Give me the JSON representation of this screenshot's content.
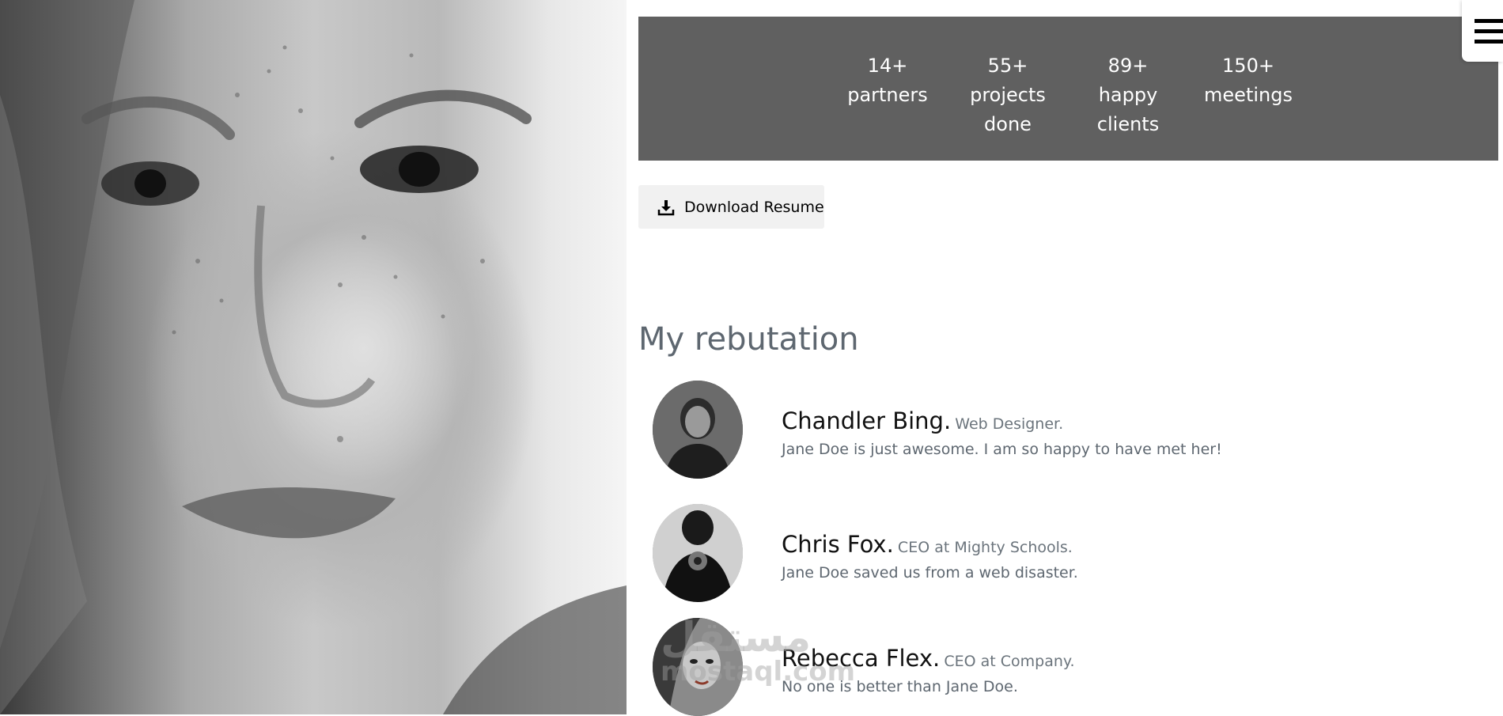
{
  "stats": [
    {
      "lines": [
        "14+",
        "partners"
      ]
    },
    {
      "lines": [
        "55+",
        "projects",
        "done"
      ]
    },
    {
      "lines": [
        "89+",
        "happy",
        "clients"
      ]
    },
    {
      "lines": [
        "150+",
        "meetings"
      ]
    }
  ],
  "download_button": {
    "label": "Download Resume",
    "icon": "download-icon"
  },
  "reputation": {
    "title": "My rebutation",
    "items": [
      {
        "name": "Chandler Bing.",
        "role": "Web Designer.",
        "quote": "Jane Doe is just awesome. I am so happy to have met her!"
      },
      {
        "name": "Chris Fox.",
        "role": "CEO at Mighty Schools.",
        "quote": "Jane Doe saved us from a web disaster."
      },
      {
        "name": "Rebecca Flex.",
        "role": "CEO at Company.",
        "quote": "No one is better than Jane Doe."
      }
    ]
  },
  "menu": {
    "icon": "hamburger-menu-icon"
  },
  "watermark": {
    "line1": "مستقل",
    "line2": "mostaql.com"
  }
}
